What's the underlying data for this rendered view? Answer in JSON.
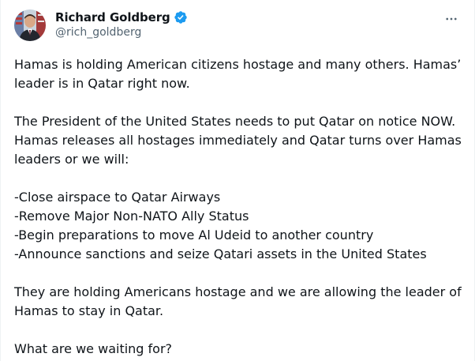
{
  "author": {
    "display_name": "Richard Goldberg",
    "handle": "@rich_goldberg",
    "verified": true,
    "verified_color": "#1d9bf0"
  },
  "tweet": {
    "paragraph1": "Hamas is holding American citizens hostage and many others. Hamas’ leader is in Qatar right now.",
    "paragraph2_line1": "The President of the United States needs to put Qatar on notice NOW.",
    "paragraph2_line2": "Hamas releases all hostages immediately and Qatar turns over Hamas leaders or we will:",
    "list": [
      "-Close airspace to Qatar Airways",
      "-Remove Major Non-NATO Ally Status",
      "-Begin preparations to move Al Udeid to another country",
      "-Announce sanctions and seize Qatari assets in the United States"
    ],
    "paragraph3": "They are holding Americans hostage and we are allowing the leader of Hamas to stay in Qatar.",
    "paragraph4": "What are we waiting for?"
  },
  "icons": {
    "more": "more-horizontal-icon",
    "verified": "verified-badge-icon"
  },
  "colors": {
    "text_primary": "#0f1419",
    "text_secondary": "#536471"
  }
}
